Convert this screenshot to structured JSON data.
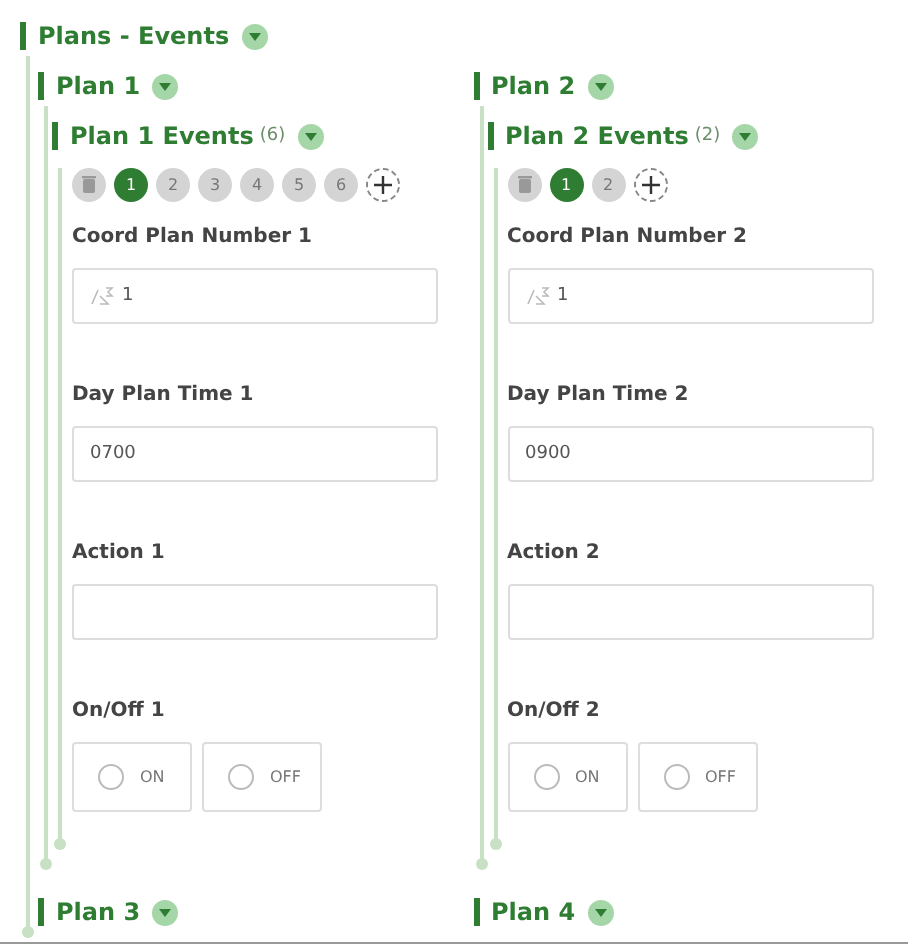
{
  "title": "Plans - Events",
  "expanded": true,
  "plans": [
    {
      "title": "Plan 1",
      "expanded": true,
      "events_title": "Plan 1 Events",
      "events_count": "(6)",
      "events_expanded": true,
      "events": [
        {
          "label": "1",
          "selected": true
        },
        {
          "label": "2",
          "selected": false
        },
        {
          "label": "3",
          "selected": false
        },
        {
          "label": "4",
          "selected": false
        },
        {
          "label": "5",
          "selected": false
        },
        {
          "label": "6",
          "selected": false
        }
      ],
      "fields": [
        {
          "kind": "number",
          "label": "Coord Plan Number 1",
          "value": "1"
        },
        {
          "kind": "text",
          "label": "Day Plan Time 1",
          "value": "0700"
        },
        {
          "kind": "text",
          "label": "Action 1"
        },
        {
          "kind": "radio",
          "label": "On/Off 1",
          "options": [
            {
              "label": "ON",
              "selected": false
            },
            {
              "label": "OFF",
              "selected": false
            }
          ]
        }
      ]
    },
    {
      "title": "Plan 2",
      "expanded": true,
      "events_title": "Plan 2 Events",
      "events_count": "(2)",
      "events_expanded": true,
      "events": [
        {
          "label": "1",
          "selected": true
        },
        {
          "label": "2",
          "selected": false
        }
      ],
      "fields": [
        {
          "kind": "number",
          "label": "Coord Plan Number 2",
          "value": "1"
        },
        {
          "kind": "text",
          "label": "Day Plan Time 2",
          "value": "0900"
        },
        {
          "kind": "text",
          "label": "Action 2"
        },
        {
          "kind": "radio",
          "label": "On/Off 2",
          "options": [
            {
              "label": "ON",
              "selected": false
            },
            {
              "label": "OFF",
              "selected": false
            }
          ]
        }
      ]
    },
    {
      "title": "Plan 3",
      "expanded": true
    },
    {
      "title": "Plan 4",
      "expanded": true
    }
  ]
}
